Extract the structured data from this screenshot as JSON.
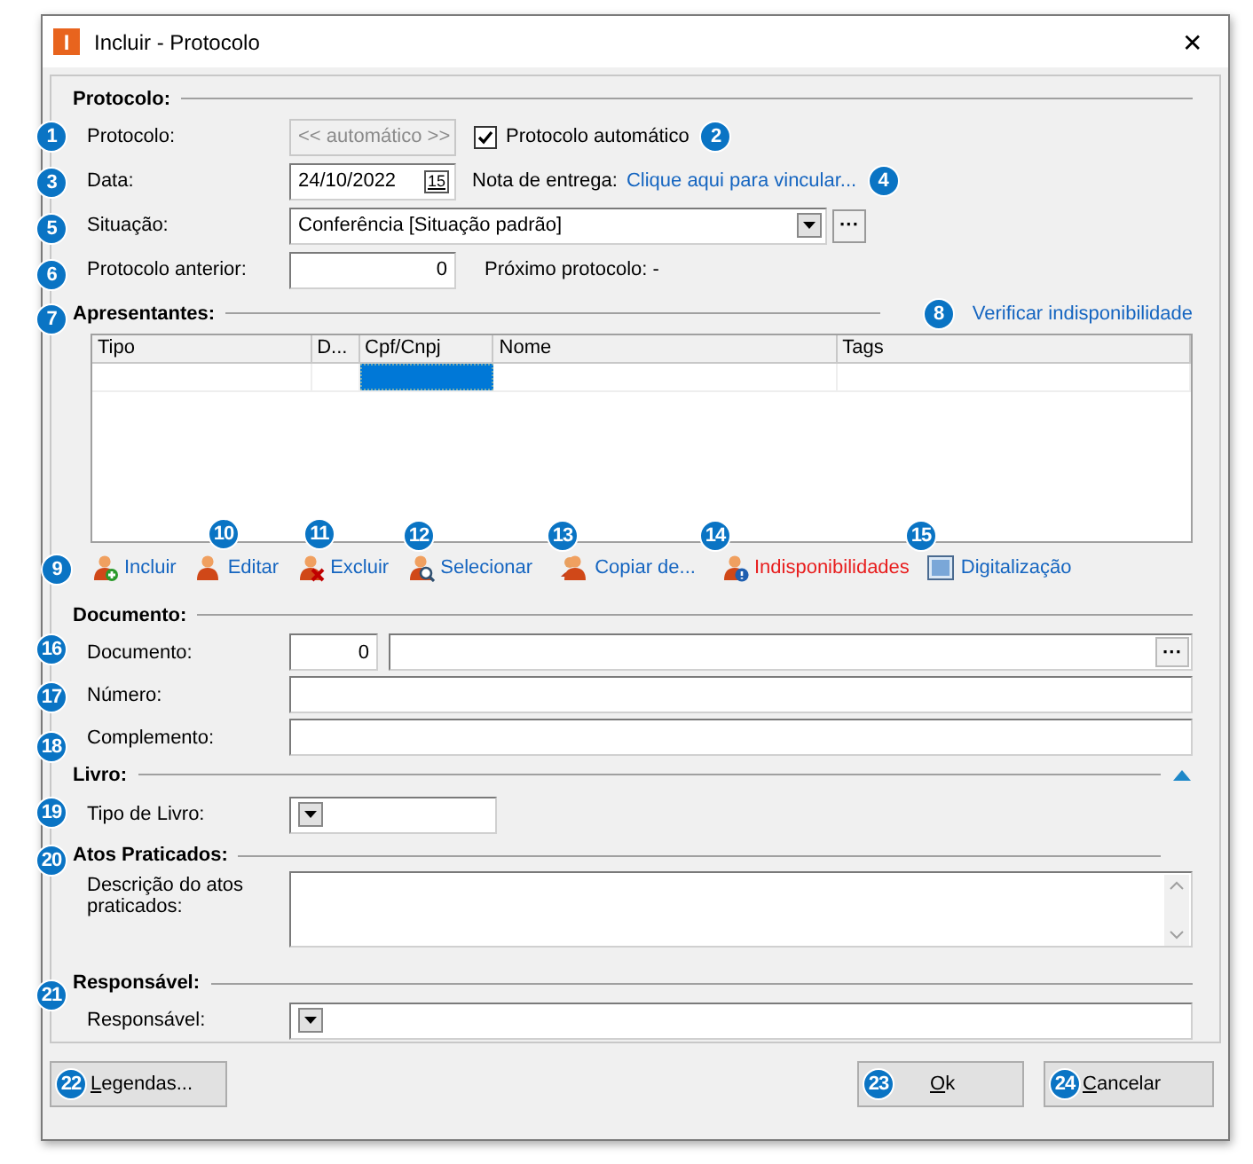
{
  "window": {
    "title": "Incluir - Protocolo",
    "app_letter": "I",
    "close": "✕"
  },
  "protocolo": {
    "heading": "Protocolo:",
    "protocolo": {
      "label": "Protocolo:",
      "placeholder": "<< automático >>",
      "disabled": true
    },
    "auto": {
      "label": "Protocolo automático",
      "checked": true
    },
    "data": {
      "label": "Data:",
      "value": "24/10/2022",
      "calendar": "15"
    },
    "nota": {
      "label": "Nota de entrega:",
      "link": "Clique aqui para vincular..."
    },
    "situacao": {
      "label": "Situação:",
      "value": "Conferência [Situação padrão]",
      "button": "···"
    },
    "anterior": {
      "label": "Protocolo anterior:",
      "value": "0"
    },
    "proximo": "Próximo protocolo: -"
  },
  "apresentantes": {
    "heading": "Apresentantes:",
    "link": "Verificar indisponibilidade",
    "columns": [
      "Tipo",
      "D...",
      "Cpf/Cnpj",
      "Nome",
      "Tags"
    ],
    "rows": [
      {
        "cells": [
          {
            "selected": false
          },
          {
            "selected": false
          },
          {
            "selected": true
          },
          {
            "selected": false
          },
          {
            "selected": false
          }
        ]
      }
    ],
    "actions": [
      {
        "label": "Incluir",
        "kind": "add",
        "alert": false
      },
      {
        "label": "Editar",
        "kind": "edit",
        "alert": false
      },
      {
        "label": "Excluir",
        "kind": "delete",
        "alert": false
      },
      {
        "label": "Selecionar",
        "kind": "search",
        "alert": false
      },
      {
        "label": "Copiar de...",
        "kind": "copy",
        "alert": false
      },
      {
        "label": "Indisponibilidades",
        "kind": "warn",
        "alert": true
      },
      {
        "label": "Digitalização",
        "kind": "scan",
        "alert": false
      }
    ]
  },
  "documento": {
    "heading": "Documento:",
    "documento": {
      "label": "Documento:",
      "number": "0",
      "button": "···"
    },
    "numero": {
      "label": "Número:"
    },
    "complemento": {
      "label": "Complemento:"
    }
  },
  "livro": {
    "heading": "Livro:",
    "expanded": true,
    "tipo": {
      "label": "Tipo de Livro:"
    }
  },
  "atos": {
    "heading": "Atos Praticados:",
    "descricao": {
      "label": "Descrição do atos praticados:"
    }
  },
  "responsavel": {
    "heading": "Responsável:",
    "field": {
      "label": "Responsável:"
    }
  },
  "buttons": [
    {
      "label": "Legendas..."
    },
    {
      "label": "Ok"
    },
    {
      "label": "Cancelar"
    }
  ],
  "callouts": [
    "1",
    "2",
    "3",
    "4",
    "5",
    "6",
    "7",
    "8",
    "9",
    "10",
    "11",
    "12",
    "13",
    "14",
    "15",
    "16",
    "17",
    "18",
    "19",
    "20",
    "21",
    "22",
    "23",
    "24"
  ]
}
